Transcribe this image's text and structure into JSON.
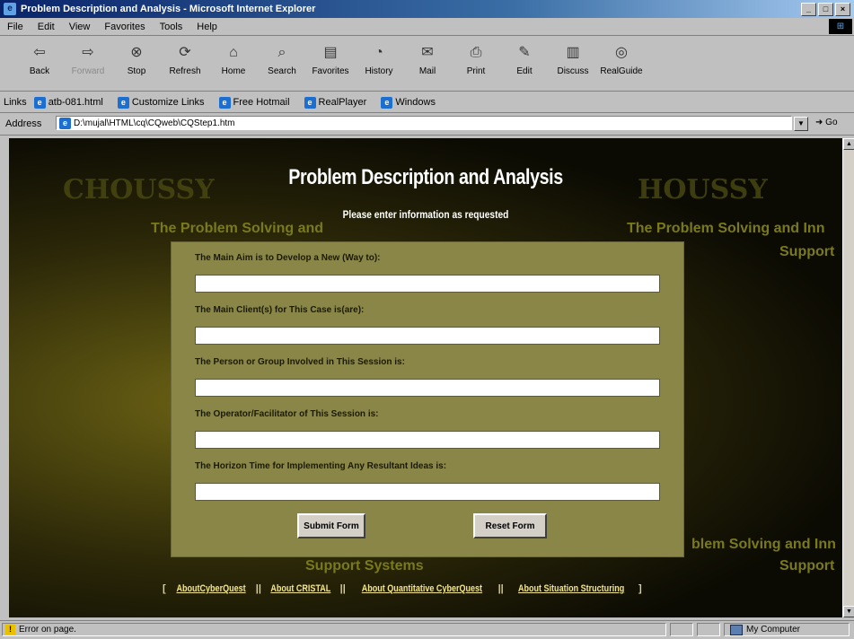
{
  "window": {
    "title": "Problem Description and Analysis - Microsoft Internet Explorer",
    "controls": [
      "minimize",
      "maximize",
      "close"
    ]
  },
  "menu": [
    "File",
    "Edit",
    "View",
    "Favorites",
    "Tools",
    "Help"
  ],
  "toolbar": [
    {
      "label": "Back",
      "icon": "back-arrow-icon",
      "enabled": true
    },
    {
      "label": "Forward",
      "icon": "forward-arrow-icon",
      "enabled": false
    },
    {
      "label": "Stop",
      "icon": "stop-icon",
      "enabled": true
    },
    {
      "label": "Refresh",
      "icon": "refresh-icon",
      "enabled": true
    },
    {
      "label": "Home",
      "icon": "home-icon",
      "enabled": true
    },
    {
      "label": "Search",
      "icon": "search-icon",
      "enabled": true
    },
    {
      "label": "Favorites",
      "icon": "favorites-icon",
      "enabled": true
    },
    {
      "label": "History",
      "icon": "history-icon",
      "enabled": true
    },
    {
      "label": "Mail",
      "icon": "mail-icon",
      "enabled": true
    },
    {
      "label": "Print",
      "icon": "print-icon",
      "enabled": true
    },
    {
      "label": "Edit",
      "icon": "edit-icon",
      "enabled": true
    },
    {
      "label": "Discuss",
      "icon": "discuss-icon",
      "enabled": true
    },
    {
      "label": "RealGuide",
      "icon": "realguide-icon",
      "enabled": true
    }
  ],
  "links": {
    "label": "Links",
    "items": [
      "atb-081.html",
      "Customize Links",
      "Free Hotmail",
      "RealPlayer",
      "Windows"
    ]
  },
  "address": {
    "label": "Address",
    "value": "D:\\mujal\\HTML\\cq\\CQweb\\CQStep1.htm",
    "go": "Go"
  },
  "page": {
    "title": "Problem Description and Analysis",
    "subtitle": "Please enter information as requested",
    "fields": [
      {
        "label": "The Main Aim is to Develop a New (Way to):",
        "value": ""
      },
      {
        "label": "The Main Client(s) for This Case is(are):",
        "value": ""
      },
      {
        "label": "The Person or Group Involved in This Session is:",
        "value": ""
      },
      {
        "label": "The Operator/Facilitator of This Session is:",
        "value": ""
      },
      {
        "label": "The Horizon Time for Implementing Any Resultant Ideas is:",
        "value": ""
      }
    ],
    "submit_label": "Submit Form",
    "reset_label": "Reset Form",
    "footer_links": [
      "AboutCyberQuest",
      "About CRISTAL",
      "About Quantitative CyberQuest",
      "About Situation Structuring"
    ],
    "background_text": [
      "The Problem Solving and",
      "The Problem Solving and Inn",
      "Support",
      "blem Solving and Inn",
      "Support Systems"
    ]
  },
  "status": {
    "message": "Error on page.",
    "zone": "My Computer"
  },
  "colors": {
    "titlebar": "#0a246a",
    "panel": "#8a8648",
    "link": "#f4e68a"
  }
}
